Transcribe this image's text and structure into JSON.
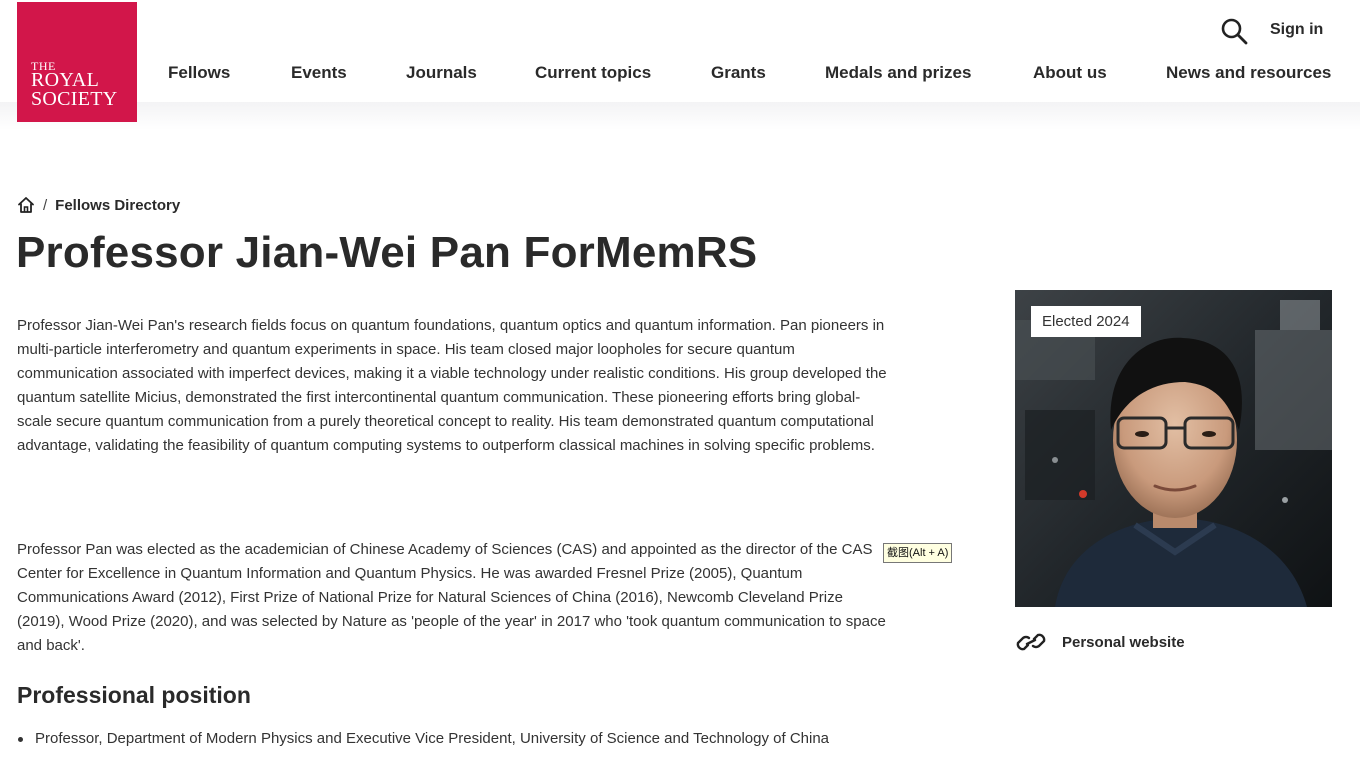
{
  "logo": {
    "line1": "THE",
    "line2": "ROYAL",
    "line3": "SOCIETY",
    "color": "#d2164a"
  },
  "nav": {
    "items": [
      "Fellows",
      "Events",
      "Journals",
      "Current topics",
      "Grants",
      "Medals and prizes",
      "About us",
      "News and resources"
    ]
  },
  "header": {
    "search_icon": "search-icon",
    "sign_in_label": "Sign in"
  },
  "breadcrumb": {
    "home_icon": "home-icon",
    "separator": "/",
    "current": "Fellows Directory"
  },
  "page": {
    "title": "Professor Jian-Wei Pan ForMemRS",
    "bio_paragraph_1": "Professor Jian-Wei Pan's research fields focus on quantum foundations, quantum optics and quantum information. Pan pioneers in multi-particle interferometry and quantum experiments in space. His team closed major loopholes for secure quantum communication associated with imperfect devices, making it a viable technology under realistic conditions. His group developed the quantum satellite Micius, demonstrated the first intercontinental quantum communication. These pioneering efforts bring global-scale secure quantum communication from a purely theoretical concept to reality. His team demonstrated quantum computational advantage, validating the feasibility of quantum computing systems to outperform classical machines in solving specific problems.",
    "bio_paragraph_2": "Professor Pan was elected as the academician of Chinese Academy of Sciences (CAS) and appointed as the director of the CAS Center for Excellence in Quantum Information and Quantum Physics. He was awarded Fresnel Prize (2005), Quantum Communications Award (2012), First Prize of National Prize for Natural Sciences of China (2016), Newcomb Cleveland Prize (2019), Wood Prize (2020), and was selected by Nature as 'people of the year' in 2017 who 'took quantum communication to space and back'.",
    "professional_position_heading": "Professional position",
    "positions": [
      "Professor, Department of Modern Physics and Executive Vice President, University of Science and Technology of China"
    ]
  },
  "sidebar": {
    "elected_badge": "Elected 2024",
    "personal_website_label": "Personal website",
    "link_icon": "link-icon"
  },
  "tooltip": {
    "text": "截图(Alt + A)"
  }
}
